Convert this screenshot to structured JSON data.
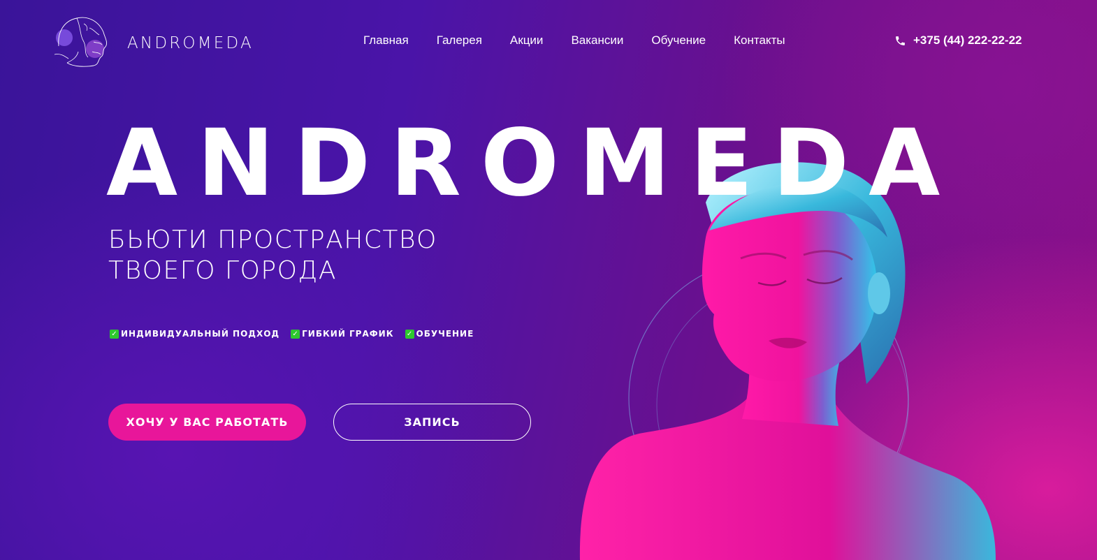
{
  "header": {
    "logo_text": "ANDROMEDA",
    "nav": [
      {
        "label": "Главная"
      },
      {
        "label": "Галерея"
      },
      {
        "label": "Акции"
      },
      {
        "label": "Вакансии"
      },
      {
        "label": "Обучение"
      },
      {
        "label": "Контакты"
      }
    ],
    "phone": "+375 (44) 222-22-22"
  },
  "hero": {
    "title": "ANDROMEDA",
    "subtitle_line1": "БЬЮТИ ПРОСТРАНСТВО",
    "subtitle_line2": "ТВОЕГО ГОРОДА",
    "features": [
      {
        "label": "ИНДИВИДУАЛЬНЫЙ ПОДХОД"
      },
      {
        "label": "ГИБКИЙ ГРАФИК"
      },
      {
        "label": "ОБУЧЕНИЕ"
      }
    ],
    "primary_button": "ХОЧУ У ВАС РАБОТАТЬ",
    "secondary_button": "ЗАПИСЬ"
  },
  "colors": {
    "accent_pink": "#e8169a",
    "background_violet": "#4a14a8",
    "check_green": "#2ec82e"
  },
  "icons": {
    "phone": "phone-icon",
    "check": "check-icon",
    "logo": "face-line-art-icon"
  }
}
